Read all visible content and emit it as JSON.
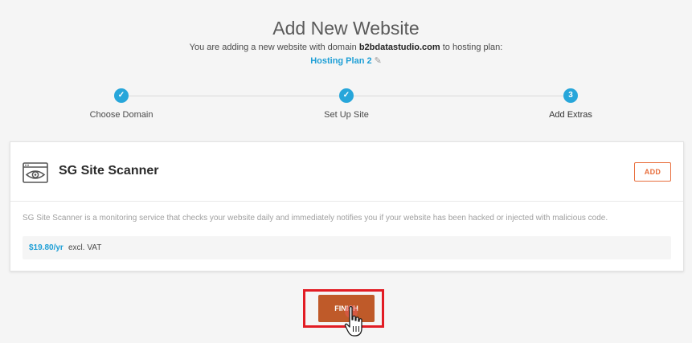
{
  "header": {
    "title": "Add New Website",
    "subtitle_prefix": "You are adding a new website with domain",
    "domain": "b2bdatastudio.com",
    "subtitle_suffix": "to hosting plan:",
    "plan_link": "Hosting Plan 2",
    "plan_edit_icon": "pencil-icon"
  },
  "stepper": {
    "steps": [
      {
        "label": "Choose Domain",
        "status": "done",
        "marker": "✓"
      },
      {
        "label": "Set Up Site",
        "status": "done",
        "marker": "✓"
      },
      {
        "label": "Add Extras",
        "status": "current",
        "marker": "3"
      }
    ]
  },
  "card": {
    "icon": "site-scanner-eye-icon",
    "title": "SG Site Scanner",
    "add_label": "ADD",
    "description": "SG Site Scanner is a monitoring service that checks your website daily and immediately notifies you if your website has been hacked or injected with malicious code.",
    "price": "$19.80/yr",
    "price_note": "excl. VAT"
  },
  "footer": {
    "finish_label": "FINISH"
  },
  "colors": {
    "accent_blue": "#27a6da",
    "add_orange": "#e86e3c",
    "finish_brown": "#bf5a29",
    "highlight_red": "#e21c24"
  }
}
